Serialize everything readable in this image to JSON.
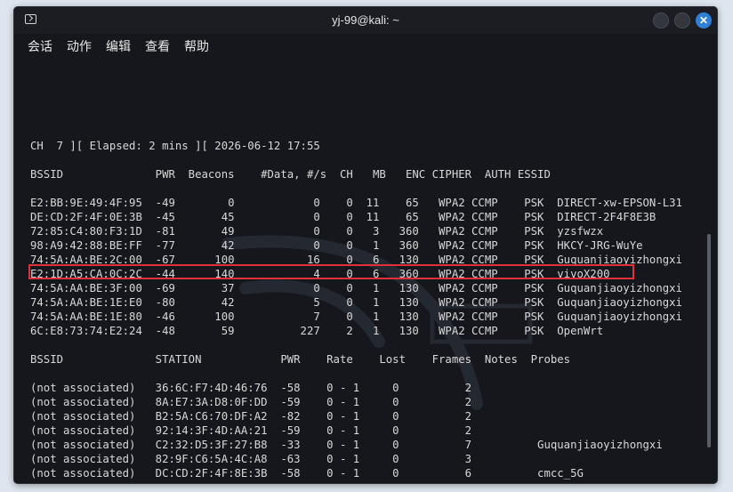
{
  "window": {
    "title": "yj-99@kali: ~"
  },
  "menu": [
    "会话",
    "动作",
    "编辑",
    "查看",
    "帮助"
  ],
  "header_line": "CH  7 ][ Elapsed: 2 mins ][ 2026-06-12 17:55",
  "ap_header": "BSSID              PWR  Beacons    #Data, #/s  CH   MB   ENC CIPHER  AUTH ESSID",
  "ap_rows": [
    {
      "bssid": "E2:BB:9E:49:4F:95",
      "pwr": "-49",
      "beacons": "0",
      "data": "0",
      "per_s": "0",
      "ch": "11",
      "mb": "65",
      "enc": "WPA2",
      "cipher": "CCMP",
      "auth": "PSK",
      "essid": "DIRECT-xw-EPSON-L31"
    },
    {
      "bssid": "DE:CD:2F:4F:0E:3B",
      "pwr": "-45",
      "beacons": "45",
      "data": "0",
      "per_s": "0",
      "ch": "11",
      "mb": "65",
      "enc": "WPA2",
      "cipher": "CCMP",
      "auth": "PSK",
      "essid": "DIRECT-2F4F8E3B"
    },
    {
      "bssid": "72:85:C4:80:F3:1D",
      "pwr": "-81",
      "beacons": "49",
      "data": "0",
      "per_s": "0",
      "ch": "3",
      "mb": "360",
      "enc": "WPA2",
      "cipher": "CCMP",
      "auth": "PSK",
      "essid": "yzsfwzx"
    },
    {
      "bssid": "98:A9:42:88:BE:FF",
      "pwr": "-77",
      "beacons": "42",
      "data": "0",
      "per_s": "0",
      "ch": "1",
      "mb": "360",
      "enc": "WPA2",
      "cipher": "CCMP",
      "auth": "PSK",
      "essid": "HKCY-JRG-WuYe"
    },
    {
      "bssid": "74:5A:AA:BE:2C:00",
      "pwr": "-67",
      "beacons": "100",
      "data": "16",
      "per_s": "0",
      "ch": "6",
      "mb": "130",
      "enc": "WPA2",
      "cipher": "CCMP",
      "auth": "PSK",
      "essid": "Guquanjiaoyizhongxi"
    },
    {
      "bssid": "E2:1D:A5:CA:0C:2C",
      "pwr": "-44",
      "beacons": "140",
      "data": "4",
      "per_s": "0",
      "ch": "6",
      "mb": "360",
      "enc": "WPA2",
      "cipher": "CCMP",
      "auth": "PSK",
      "essid": "vivoX200"
    },
    {
      "bssid": "74:5A:AA:BE:3F:00",
      "pwr": "-69",
      "beacons": "37",
      "data": "0",
      "per_s": "0",
      "ch": "1",
      "mb": "130",
      "enc": "WPA2",
      "cipher": "CCMP",
      "auth": "PSK",
      "essid": "Guquanjiaoyizhongxi"
    },
    {
      "bssid": "74:5A:AA:BE:1E:E0",
      "pwr": "-80",
      "beacons": "42",
      "data": "5",
      "per_s": "0",
      "ch": "1",
      "mb": "130",
      "enc": "WPA2",
      "cipher": "CCMP",
      "auth": "PSK",
      "essid": "Guquanjiaoyizhongxi"
    },
    {
      "bssid": "74:5A:AA:BE:1E:80",
      "pwr": "-46",
      "beacons": "100",
      "data": "7",
      "per_s": "0",
      "ch": "1",
      "mb": "130",
      "enc": "WPA2",
      "cipher": "CCMP",
      "auth": "PSK",
      "essid": "Guquanjiaoyizhongxi"
    },
    {
      "bssid": "6C:E8:73:74:E2:24",
      "pwr": "-48",
      "beacons": "59",
      "data": "227",
      "per_s": "2",
      "ch": "1",
      "mb": "130",
      "enc": "WPA2",
      "cipher": "CCMP",
      "auth": "PSK",
      "essid": "OpenWrt"
    }
  ],
  "highlighted_bssid": "E2:1D:A5:CA:0C:2C",
  "station_header": "BSSID              STATION            PWR    Rate    Lost    Frames  Notes  Probes",
  "station_rows": [
    {
      "bssid": "(not associated)",
      "station": "36:6C:F7:4D:46:76",
      "pwr": "-58",
      "rate": "0 - 1",
      "lost": "0",
      "frames": "2",
      "probes": ""
    },
    {
      "bssid": "(not associated)",
      "station": "8A:E7:3A:D8:0F:DD",
      "pwr": "-59",
      "rate": "0 - 1",
      "lost": "0",
      "frames": "2",
      "probes": ""
    },
    {
      "bssid": "(not associated)",
      "station": "B2:5A:C6:70:DF:A2",
      "pwr": "-82",
      "rate": "0 - 1",
      "lost": "0",
      "frames": "2",
      "probes": ""
    },
    {
      "bssid": "(not associated)",
      "station": "92:14:3F:4D:AA:21",
      "pwr": "-59",
      "rate": "0 - 1",
      "lost": "0",
      "frames": "2",
      "probes": ""
    },
    {
      "bssid": "(not associated)",
      "station": "C2:32:D5:3F:27:B8",
      "pwr": "-33",
      "rate": "0 - 1",
      "lost": "0",
      "frames": "7",
      "probes": "Guquanjiaoyizhongxi"
    },
    {
      "bssid": "(not associated)",
      "station": "82:9F:C6:5A:4C:A8",
      "pwr": "-63",
      "rate": "0 - 1",
      "lost": "0",
      "frames": "3",
      "probes": ""
    },
    {
      "bssid": "(not associated)",
      "station": "DC:CD:2F:4F:8E:3B",
      "pwr": "-58",
      "rate": "0 - 1",
      "lost": "0",
      "frames": "6",
      "probes": "cmcc_5G"
    }
  ],
  "colors": {
    "terminal_bg": "#15171c",
    "text": "#d8d8d8",
    "highlight_box": "#e0303a",
    "close_button": "#2e7fd6"
  },
  "icons": [
    "terminal-icon",
    "minimize-icon",
    "maximize-icon",
    "close-icon",
    "kali-dragon-watermark-icon"
  ]
}
